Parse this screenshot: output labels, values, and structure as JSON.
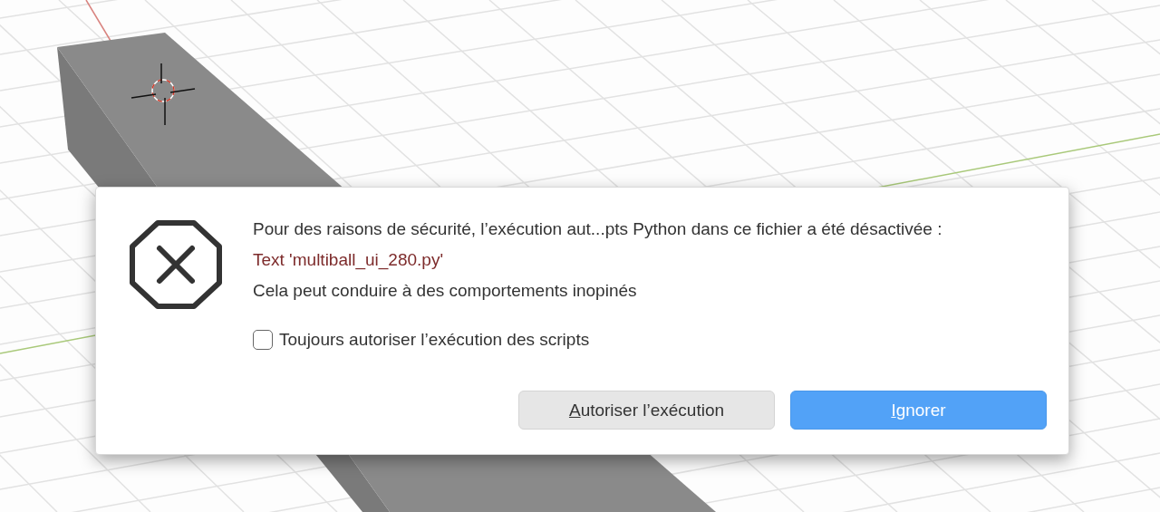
{
  "dialog": {
    "message": "Pour des raisons de sécurité, l’exécution aut...pts Python dans ce fichier a été désactivée :",
    "file": "Text 'multiball_ui_280.py'",
    "warning": "Cela peut conduire à des comportements inopinés",
    "checkbox": {
      "label": "Toujours autoriser l’exécution des scripts",
      "checked": false
    },
    "buttons": [
      {
        "label": "Autoriser l’exécution",
        "kind": "secondary"
      },
      {
        "label": "Ignorer",
        "kind": "primary"
      }
    ]
  }
}
